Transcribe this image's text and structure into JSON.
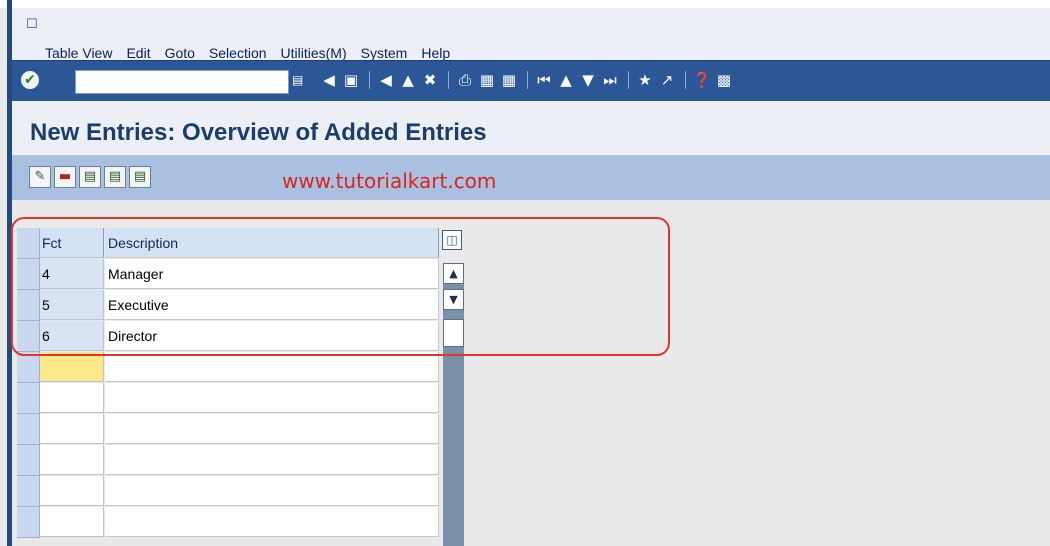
{
  "menu": {
    "items": [
      {
        "label": "Table View"
      },
      {
        "label": "Edit"
      },
      {
        "label": "Goto"
      },
      {
        "label": "Selection"
      },
      {
        "label": "Utilities(M)"
      },
      {
        "label": "System"
      },
      {
        "label": "Help"
      }
    ]
  },
  "toolbar": {
    "command_field_value": "",
    "icons": [
      "enter-icon",
      "back-icon",
      "save-icon",
      "back-arrow-icon",
      "exit-icon",
      "cancel-icon",
      "print-icon",
      "find-icon",
      "find-next-icon",
      "first-page-icon",
      "previous-page-icon",
      "next-page-icon",
      "last-page-icon",
      "new-session-icon",
      "shortcut-icon",
      "help-icon",
      "customize-layout-icon"
    ]
  },
  "title": {
    "text": "New Entries: Overview of Added Entries"
  },
  "app_toolbar": {
    "icons": [
      "change-display-icon",
      "delete-icon",
      "select-all-icon",
      "select-block-icon",
      "deselect-all-icon"
    ],
    "watermark": "www.tutorialkart.com"
  },
  "table": {
    "columns": [
      "Fct",
      "Description"
    ],
    "rows": [
      {
        "fct": "4",
        "description": "Manager"
      },
      {
        "fct": "5",
        "description": "Executive"
      },
      {
        "fct": "6",
        "description": "Director"
      }
    ],
    "empty_rows": 6
  },
  "colors": {
    "toolbar_bg": "#2b5797",
    "title_color": "#1a3d6b",
    "app_toolbar_bg": "#a9c0e0",
    "highlight": "#e03530",
    "watermark": "#d9251c"
  }
}
